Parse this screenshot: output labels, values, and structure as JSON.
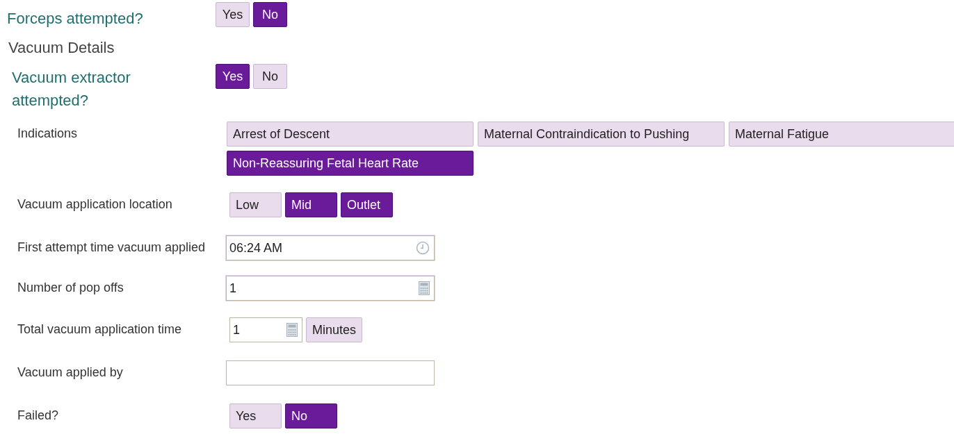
{
  "rows": [
    {
      "kind": "question",
      "label": "Forceps attempted?",
      "options": [
        {
          "label": "Yes",
          "selected": false
        },
        {
          "label": "No",
          "selected": true
        }
      ]
    },
    {
      "kind": "heading",
      "label": "Vacuum Details"
    },
    {
      "kind": "question",
      "label": "Vacuum extractor attempted?",
      "options": [
        {
          "label": "Yes",
          "selected": true
        },
        {
          "label": "No",
          "selected": false
        }
      ]
    },
    {
      "kind": "chips",
      "label": "Indications",
      "options": [
        {
          "label": "Arrest of Descent",
          "selected": false
        },
        {
          "label": "Maternal Contraindication to Pushing",
          "selected": false
        },
        {
          "label": "Maternal Fatigue",
          "selected": false
        },
        {
          "label": "Non-Reassuring Fetal Heart Rate",
          "selected": true
        }
      ]
    },
    {
      "kind": "options",
      "label": "Vacuum application location",
      "options": [
        {
          "label": "Low",
          "selected": false
        },
        {
          "label": "Mid",
          "selected": true
        },
        {
          "label": "Outlet",
          "selected": true
        }
      ]
    },
    {
      "kind": "time",
      "label": "First attempt time vacuum applied",
      "value": "06:24 AM"
    },
    {
      "kind": "number",
      "label": "Number of pop offs",
      "value": "1"
    },
    {
      "kind": "number-unit",
      "label": "Total vacuum application time",
      "value": "1",
      "unit": "Minutes"
    },
    {
      "kind": "text",
      "label": "Vacuum applied by"
    },
    {
      "kind": "options",
      "label": "Failed?",
      "options": [
        {
          "label": "Yes",
          "selected": false
        },
        {
          "label": "No",
          "selected": true
        }
      ]
    }
  ]
}
